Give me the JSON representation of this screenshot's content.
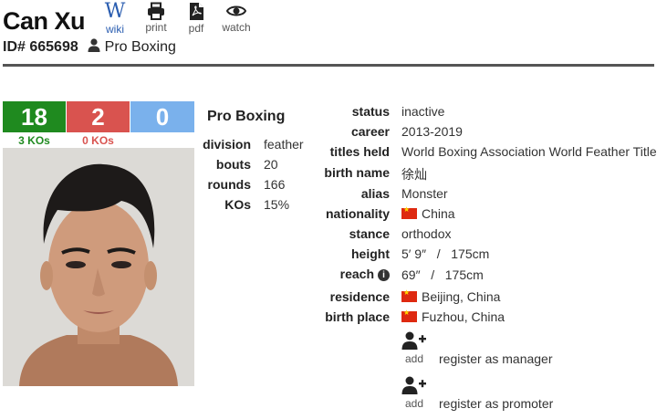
{
  "header": {
    "name": "Can Xu",
    "id_label": "ID# 665698",
    "discipline": "Pro Boxing",
    "tools": [
      {
        "label": "wiki",
        "icon": "wikipedia-icon"
      },
      {
        "label": "print",
        "icon": "printer-icon"
      },
      {
        "label": "pdf",
        "icon": "pdf-icon"
      },
      {
        "label": "watch",
        "icon": "eye-icon"
      }
    ]
  },
  "record": {
    "wins": "18",
    "losses": "2",
    "draws": "0",
    "wins_kos": "3 KOs",
    "losses_kos": "0 KOs",
    "colors": {
      "wins": "#1f8a1f",
      "losses": "#d9534f",
      "draws": "#7ab1ec"
    }
  },
  "stats": {
    "title": "Pro Boxing",
    "rows": [
      {
        "key": "division",
        "value": "feather"
      },
      {
        "key": "bouts",
        "value": "20"
      },
      {
        "key": "rounds",
        "value": "166"
      },
      {
        "key": "KOs",
        "value": "15%"
      }
    ]
  },
  "details": {
    "status": {
      "key": "status",
      "value": "inactive"
    },
    "career": {
      "key": "career",
      "value": "2013-2019"
    },
    "titles": {
      "key": "titles held",
      "value": "World Boxing Association World Feather Title"
    },
    "birth_name": {
      "key": "birth name",
      "value": "徐灿"
    },
    "alias": {
      "key": "alias",
      "value": "Monster"
    },
    "nationality": {
      "key": "nationality",
      "value": "China"
    },
    "stance": {
      "key": "stance",
      "value": "orthodox"
    },
    "height": {
      "key": "height",
      "value": "5′ 9″   /   175cm"
    },
    "reach": {
      "key": "reach",
      "value": "69″   /   175cm",
      "info": "i"
    },
    "residence": {
      "key": "residence",
      "value": "Beijing, China"
    },
    "birth_place": {
      "key": "birth place",
      "value": "Fuzhou, China"
    }
  },
  "register": {
    "manager": {
      "icon_label": "add",
      "label": "register as manager"
    },
    "promoter": {
      "icon_label": "add",
      "label": "register as promoter"
    }
  }
}
